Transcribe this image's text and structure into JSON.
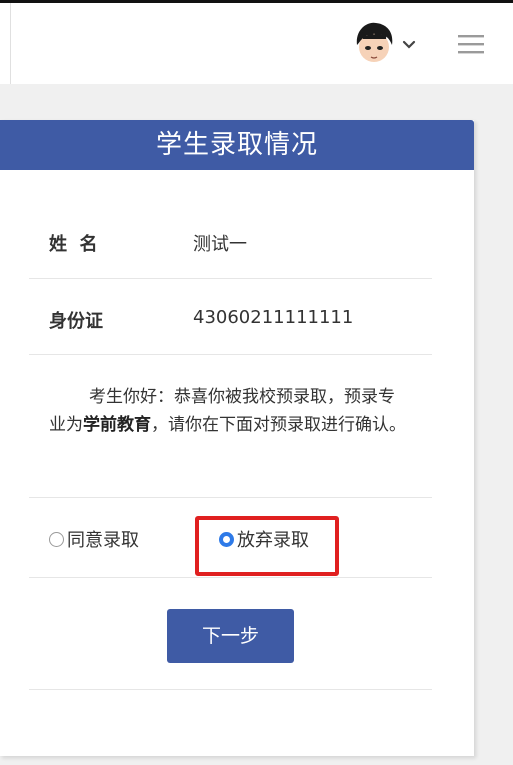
{
  "header": {
    "avatar_icon": "user-avatar",
    "chevron_icon": "chevron-down-icon",
    "menu_icon": "hamburger-menu-icon"
  },
  "card": {
    "title": "学生录取情况",
    "name_label": "姓  名",
    "name_value": "测试一",
    "id_label": "身份证",
    "id_value": "43060211111111",
    "notice_part1": "考生你好：恭喜你被我校预录取，预录专业为",
    "notice_major": "学前教育",
    "notice_part2": "，请你在下面对预录取进行确认。",
    "options": [
      {
        "label": "同意录取",
        "selected": false
      },
      {
        "label": "放弃录取",
        "selected": true
      }
    ],
    "next_label": "下一步"
  },
  "colors": {
    "brand": "#3f5ba5",
    "radio_selected": "#2e7ae8",
    "highlight": "#e02020"
  }
}
